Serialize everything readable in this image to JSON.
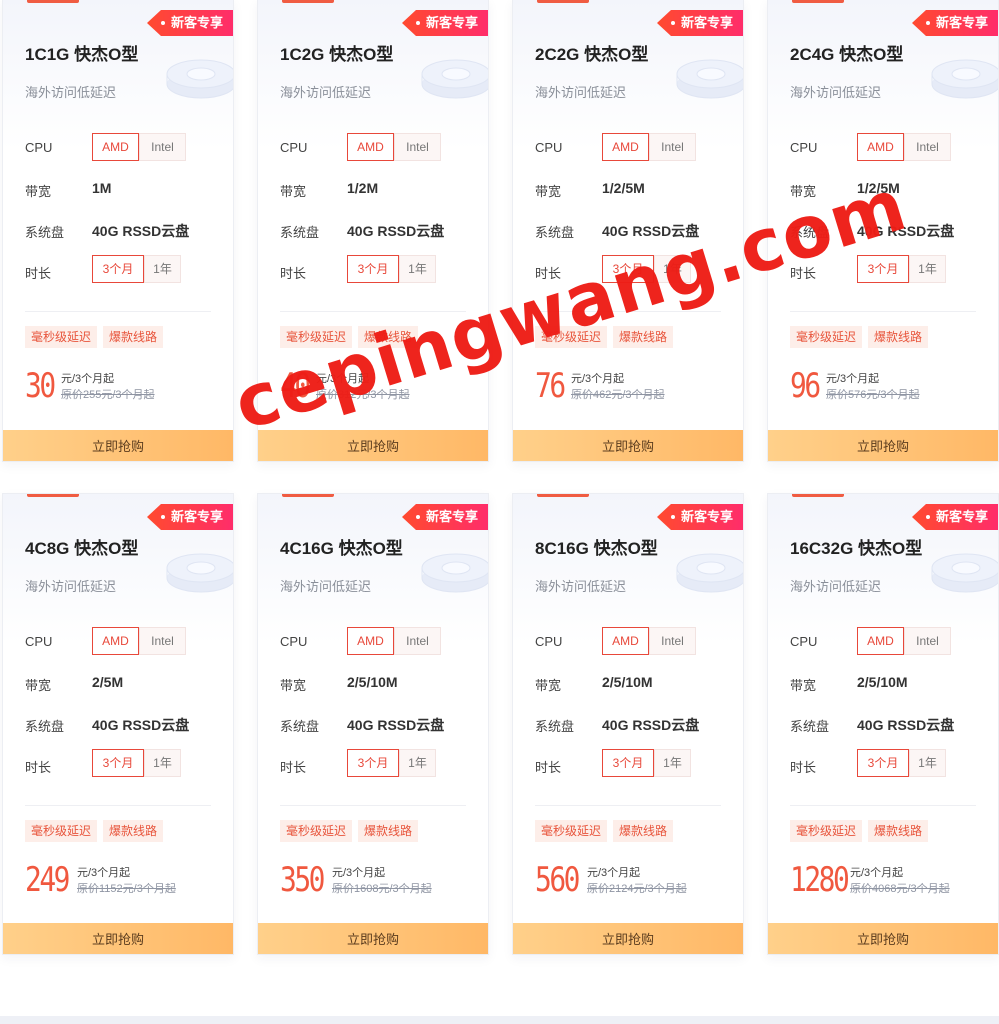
{
  "tag_label": "新客专享",
  "subtitle": "海外访问低延迟",
  "labels": {
    "cpu": "CPU",
    "bandwidth": "带宽",
    "disk": "系统盘",
    "duration": "时长"
  },
  "cpu_options": [
    "AMD",
    "Intel"
  ],
  "duration_options": [
    "3个月",
    "1年"
  ],
  "badges": [
    "毫秒级延迟",
    "爆款线路"
  ],
  "price_unit": "元/3个月起",
  "buy_label": "立即抢购",
  "watermark": "cepingwang.com",
  "colors": {
    "accent": "#f0583f",
    "tag": "#ff3b4d",
    "button": "#ffc678"
  },
  "cards": [
    {
      "title": "1C1G 快杰O型",
      "bandwidth": "1M",
      "disk": "40G RSSD云盘",
      "price": "30",
      "original": "原价255元/3个月起"
    },
    {
      "title": "1C2G 快杰O型",
      "bandwidth": "1/2M",
      "disk": "40G RSSD云盘",
      "price": "40",
      "original": "原价312元/3个月起"
    },
    {
      "title": "2C2G 快杰O型",
      "bandwidth": "1/2/5M",
      "disk": "40G RSSD云盘",
      "price": "76",
      "original": "原价462元/3个月起"
    },
    {
      "title": "2C4G 快杰O型",
      "bandwidth": "1/2/5M",
      "disk": "40G RSSD云盘",
      "price": "96",
      "original": "原价576元/3个月起"
    },
    {
      "title": "4C8G 快杰O型",
      "bandwidth": "2/5M",
      "disk": "40G RSSD云盘",
      "price": "249",
      "original": "原价1152元/3个月起"
    },
    {
      "title": "4C16G 快杰O型",
      "bandwidth": "2/5/10M",
      "disk": "40G RSSD云盘",
      "price": "350",
      "original": "原价1608元/3个月起"
    },
    {
      "title": "8C16G 快杰O型",
      "bandwidth": "2/5/10M",
      "disk": "40G RSSD云盘",
      "price": "560",
      "original": "原价2124元/3个月起"
    },
    {
      "title": "16C32G 快杰O型",
      "bandwidth": "2/5/10M",
      "disk": "40G RSSD云盘",
      "price": "1280",
      "original": "原价4068元/3个月起"
    }
  ]
}
